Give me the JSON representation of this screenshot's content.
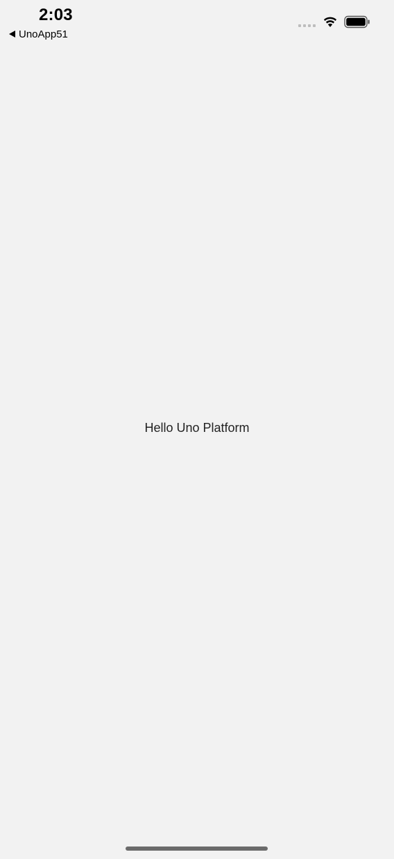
{
  "status_bar": {
    "time": "2:03",
    "back_app_label": "UnoApp51",
    "icons": [
      "back-arrow-icon",
      "cellular-signal-icon",
      "wifi-icon",
      "battery-icon"
    ]
  },
  "main": {
    "text": "Hello Uno Platform"
  },
  "colors": {
    "background": "#f2f2f2",
    "text": "#1a1a1a",
    "home_indicator": "#6b6b6b"
  }
}
